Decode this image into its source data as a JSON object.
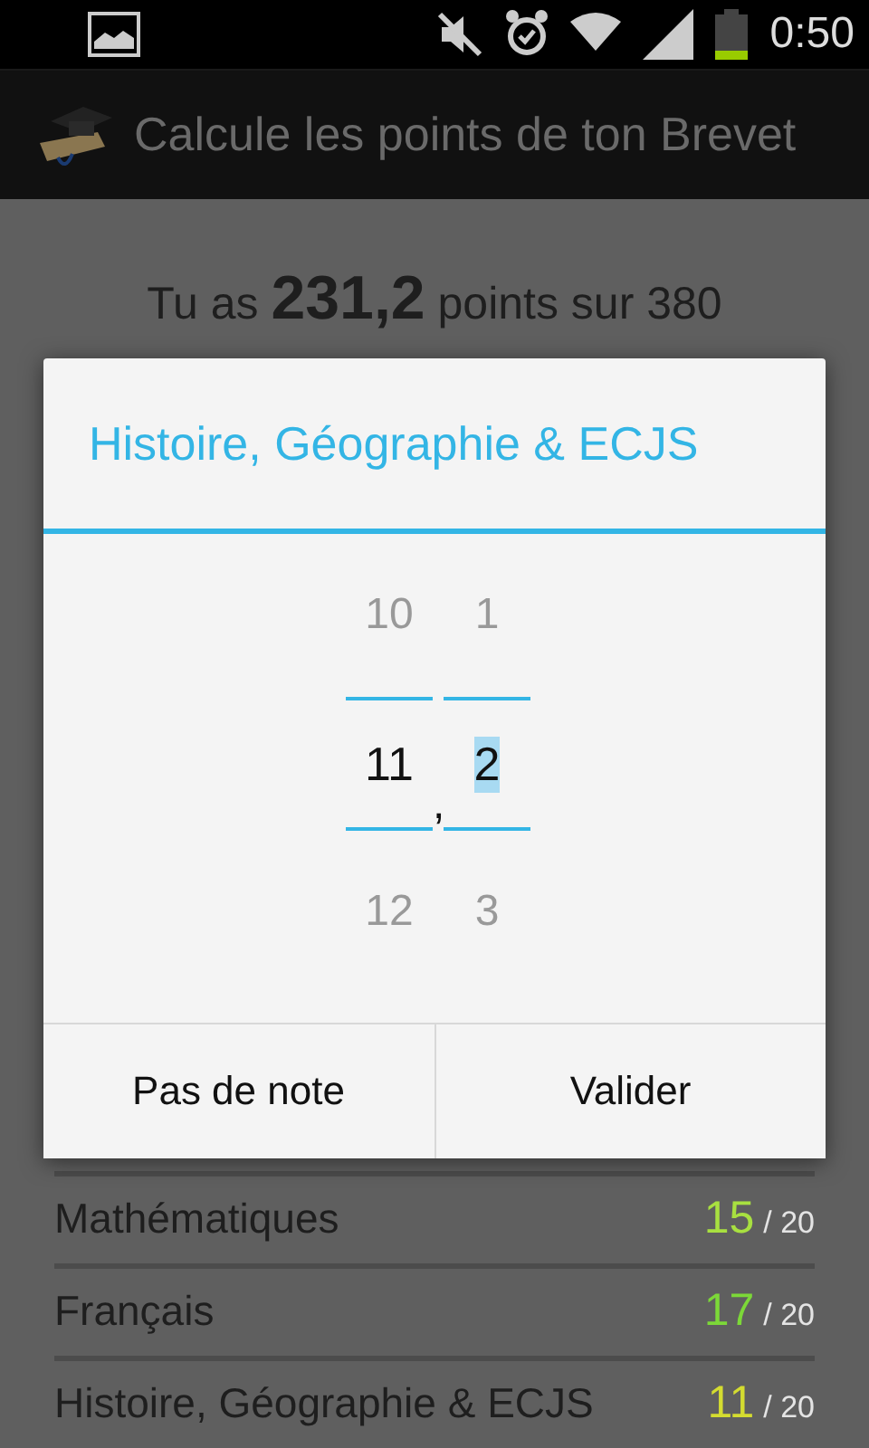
{
  "status_bar": {
    "time": "0:50"
  },
  "action_bar": {
    "title": "Calcule les points de ton Brevet"
  },
  "summary": {
    "text": "Tu as **231,2** points sur 380"
  },
  "subjects": [
    {
      "name": "Mathématiques",
      "score": "15",
      "max": "/ 20",
      "color": "#a8e040"
    },
    {
      "name": "Français",
      "score": "17",
      "max": "/ 20",
      "color": "#7cd838"
    },
    {
      "name": "Histoire, Géographie & ECJS",
      "score": "11",
      "max": "/ 20",
      "color": "#d4dc30"
    }
  ],
  "dialog": {
    "title": "Histoire, Géographie & ECJS",
    "pickers": [
      {
        "above": "10",
        "value": "11",
        "below": "12",
        "text_selected": false
      },
      {
        "above": "1",
        "value": "2",
        "below": "3",
        "text_selected": true
      }
    ],
    "separator": ",",
    "buttons": [
      "Pas de note",
      "Valider"
    ]
  }
}
